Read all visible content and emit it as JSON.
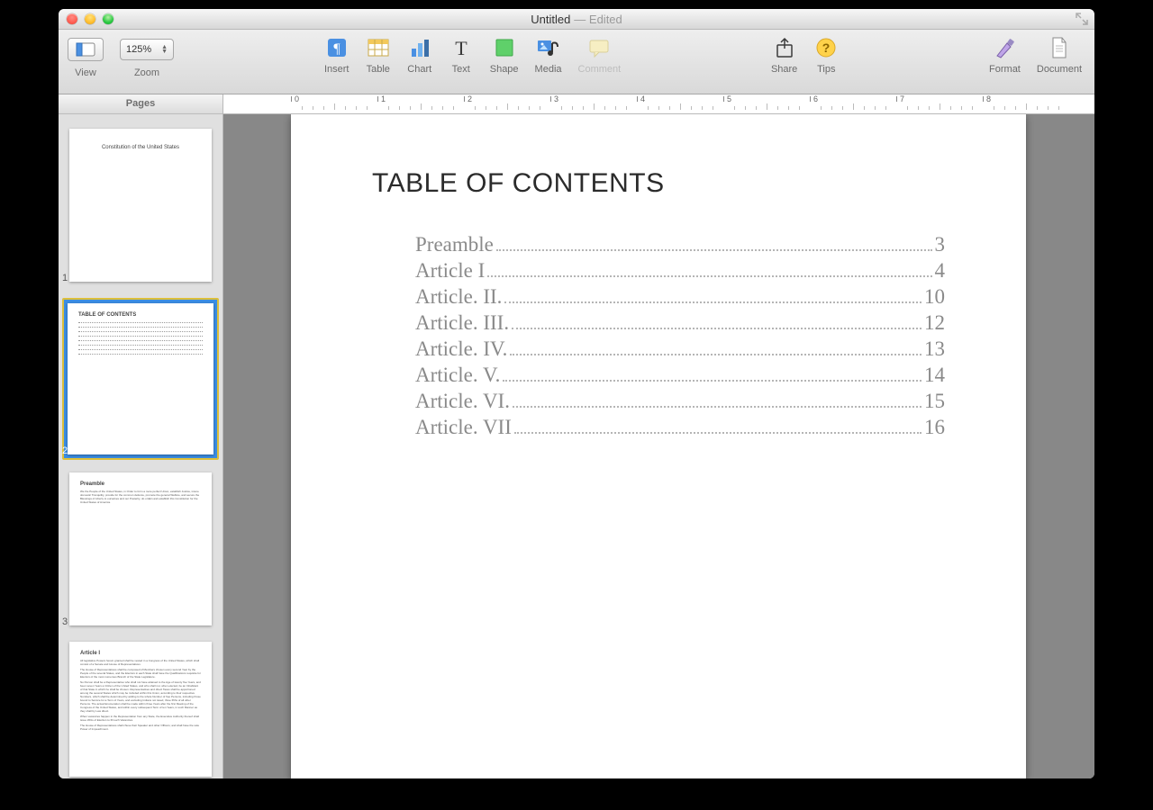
{
  "window": {
    "title": "Untitled",
    "status": "— Edited"
  },
  "toolbar": {
    "view": "View",
    "zoom_label": "Zoom",
    "zoom_value": "125%",
    "insert": "Insert",
    "table": "Table",
    "chart": "Chart",
    "text": "Text",
    "shape": "Shape",
    "media": "Media",
    "comment": "Comment",
    "share": "Share",
    "tips": "Tips",
    "format": "Format",
    "document": "Document"
  },
  "sidebar": {
    "title": "Pages",
    "thumbs": {
      "p1": {
        "num": "1",
        "title": "Constitution of the United States"
      },
      "p2": {
        "num": "2",
        "title": "TABLE OF CONTENTS"
      },
      "p3": {
        "num": "3",
        "title": "Preamble"
      },
      "p4": {
        "title": "Article I"
      }
    }
  },
  "ruler": {
    "marks": [
      "0",
      "1",
      "2",
      "3",
      "4",
      "5",
      "6",
      "7",
      "8"
    ]
  },
  "document": {
    "toc_heading": "TABLE OF CONTENTS",
    "toc": [
      {
        "label": "Preamble",
        "page": "3"
      },
      {
        "label": "Article I",
        "page": "4"
      },
      {
        "label": "Article. II.",
        "page": "10"
      },
      {
        "label": "Article. III.",
        "page": "12"
      },
      {
        "label": "Article. IV.",
        "page": "13"
      },
      {
        "label": "Article. V.",
        "page": "14"
      },
      {
        "label": "Article. VI.",
        "page": "15"
      },
      {
        "label": "Article. VII",
        "page": "16"
      }
    ]
  }
}
